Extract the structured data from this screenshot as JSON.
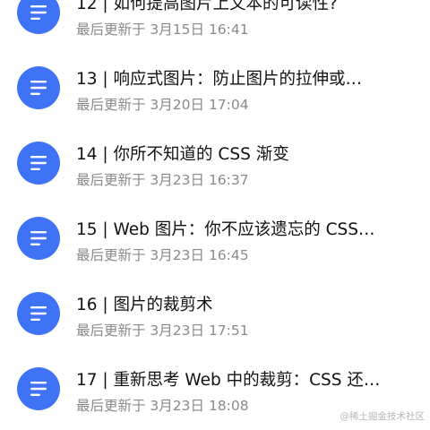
{
  "colors": {
    "icon_background": "#3f73f6",
    "title_text": "#111111",
    "subtitle_text": "#8a8a8e"
  },
  "list": {
    "item_icon": "document-lines-icon",
    "items": [
      {
        "title": "12 | 如何提高图片上文本的可读性?",
        "subtitle": "最后更新于 3月15日 16:41"
      },
      {
        "title": "13 | 响应式图片：防止图片的拉伸或…",
        "subtitle": "最后更新于 3月20日 17:04"
      },
      {
        "title": "14 | 你所不知道的 CSS 渐变",
        "subtitle": "最后更新于 3月23日 16:37"
      },
      {
        "title": "15 | Web 图片：你不应该遗忘的 CSS…",
        "subtitle": "最后更新于 3月23日 16:45"
      },
      {
        "title": "16 | 图片的裁剪术",
        "subtitle": "最后更新于 3月23日 17:51"
      },
      {
        "title": "17 | 重新思考 Web 中的裁剪：CSS 还…",
        "subtitle": "最后更新于 3月23日 18:08"
      }
    ]
  },
  "watermark": {
    "text": "@稀土掘金技术社区"
  }
}
